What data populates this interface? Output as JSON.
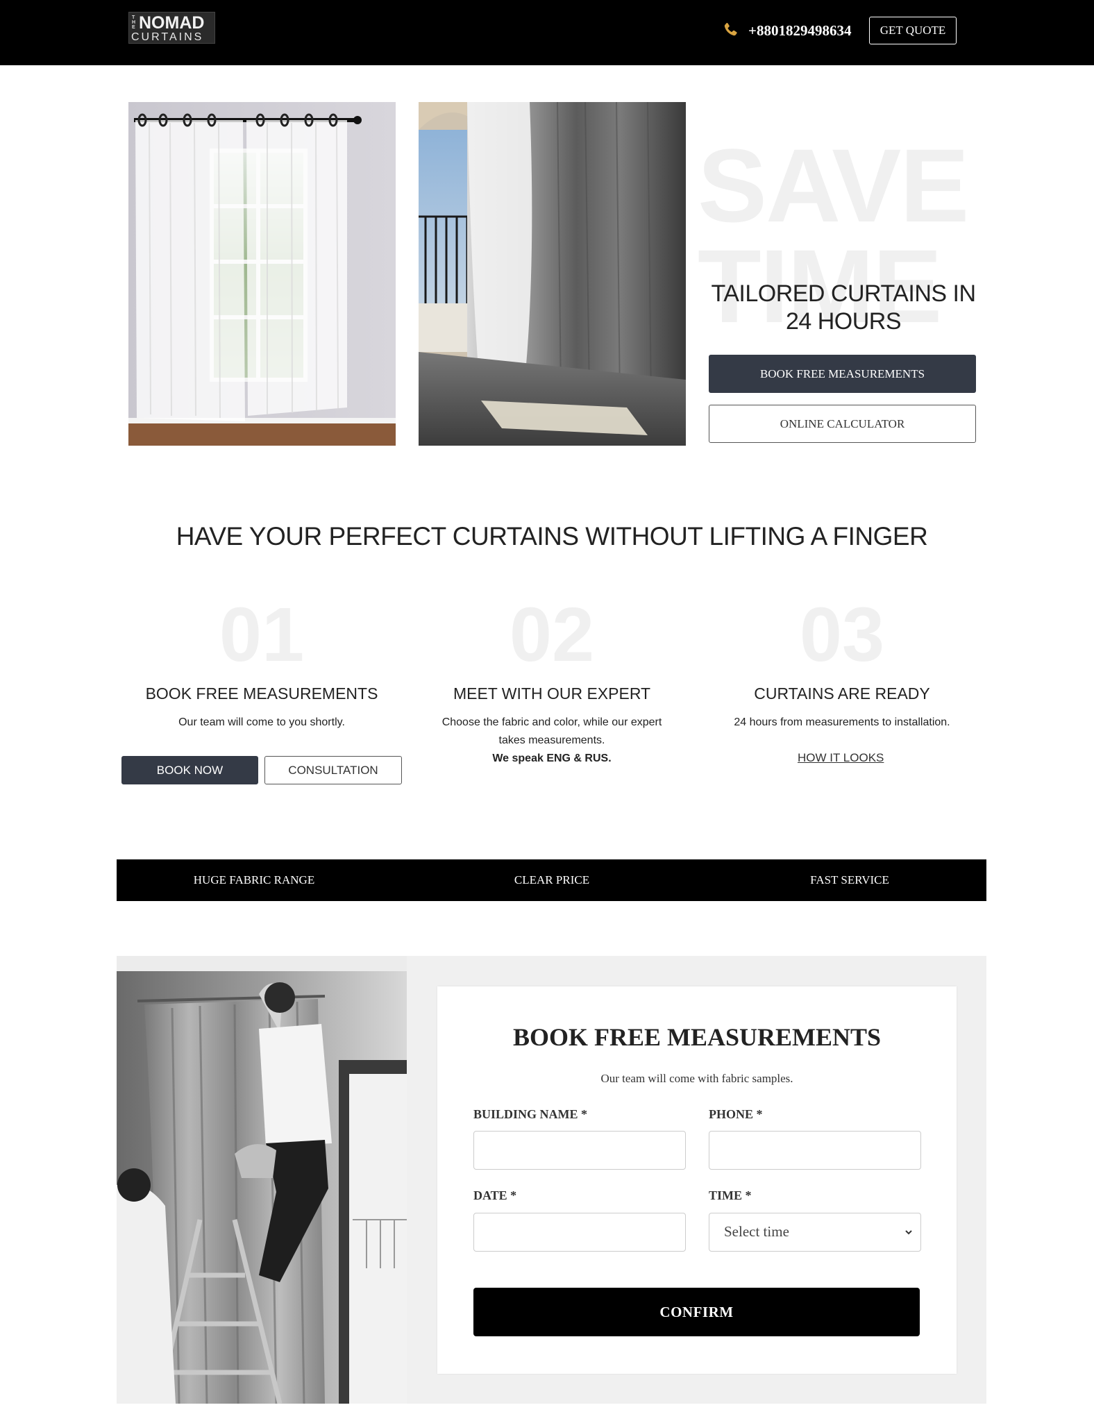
{
  "header": {
    "logo_the": "THE",
    "logo_nomad": "NOMAD",
    "logo_curtains": "CURTAINS",
    "phone": "+8801829498634",
    "quote_button": "GET QUOTE",
    "phone_icon": "phone-icon",
    "accent_color": "#d9a441"
  },
  "hero": {
    "bg_text_line1": "SAVE",
    "bg_text_line2": "TIME",
    "title_line1": "TAILORED CURTAINS IN",
    "title_line2": "24 HOURS",
    "primary_button": "BOOK FREE MEASUREMENTS",
    "secondary_button": "ONLINE CALCULATOR"
  },
  "steps_section": {
    "heading": "HAVE YOUR PERFECT CURTAINS WITHOUT LIFTING A FINGER",
    "steps": [
      {
        "number": "01",
        "title": "BOOK FREE MEASUREMENTS",
        "desc": "Our team will come to you shortly.",
        "button_primary": "BOOK NOW",
        "button_secondary": "CONSULTATION"
      },
      {
        "number": "02",
        "title": "MEET WITH OUR EXPERT",
        "desc_line1": "Choose the fabric and color, while our expert",
        "desc_line2": "takes measurements.",
        "desc_bold": "We speak ENG & RUS."
      },
      {
        "number": "03",
        "title": "CURTAINS ARE READY",
        "desc": "24 hours from measurements to installation.",
        "link": "HOW IT LOOKS"
      }
    ]
  },
  "features": [
    "HUGE FABRIC RANGE",
    "CLEAR PRICE",
    "FAST SERVICE"
  ],
  "booking": {
    "title": "BOOK FREE MEASUREMENTS",
    "subtitle": "Our team will come with fabric samples.",
    "fields": {
      "building_label": "BUILDING NAME *",
      "building_value": "",
      "phone_label": "PHONE *",
      "phone_value": "",
      "date_label": "DATE *",
      "date_value": "",
      "time_label": "TIME *",
      "time_selected": "Select time"
    },
    "confirm_button": "CONFIRM"
  }
}
